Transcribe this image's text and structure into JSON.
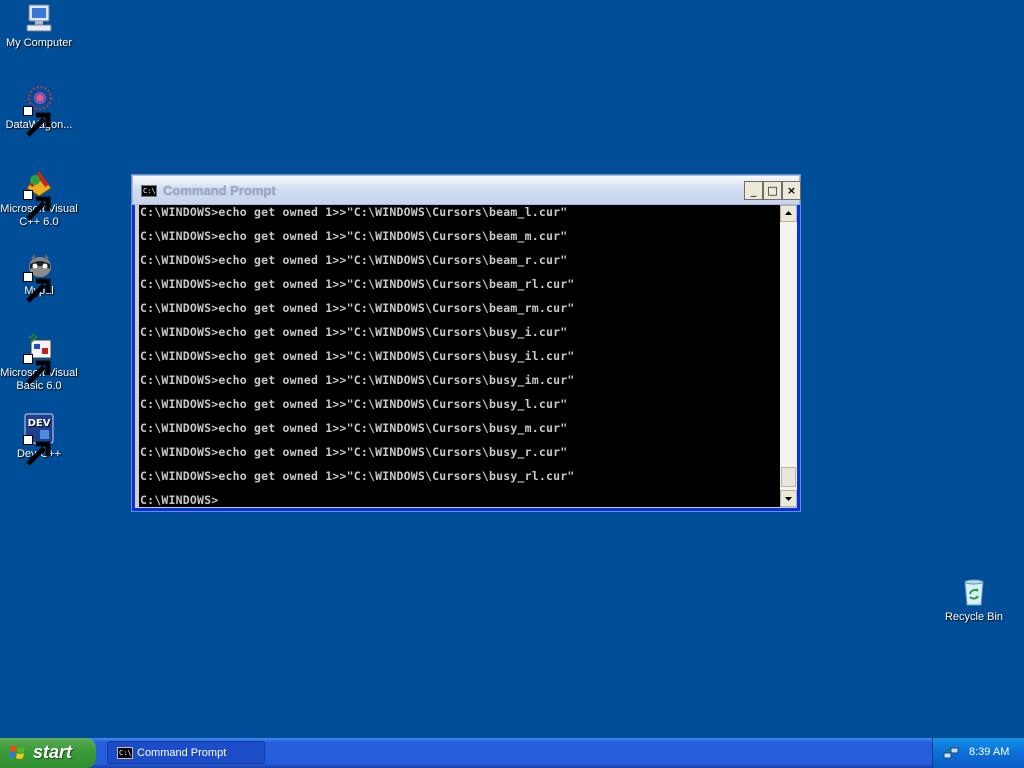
{
  "desktop": {
    "icons": [
      {
        "label": "My Computer",
        "icon": "my-computer-icon"
      },
      {
        "label": "DataWagon...",
        "icon": "datawagon-icon"
      },
      {
        "label": "Microsoft Visual C++ 6.0",
        "icon": "visual-cpp-icon"
      },
      {
        "label": "Mypal",
        "icon": "mypal-icon"
      },
      {
        "label": "Microsoft Visual Basic 6.0",
        "icon": "visual-basic-icon"
      },
      {
        "label": "Dev-C++",
        "icon": "dev-cpp-icon"
      },
      {
        "label": "Recycle Bin",
        "icon": "recycle-bin-icon"
      }
    ]
  },
  "window": {
    "title": "Command Prompt",
    "icon_text": "C:\\",
    "buttons": {
      "minimize": "_",
      "maximize": "□",
      "close": "×"
    },
    "console_lines": [
      "C:\\WINDOWS>echo get owned 1>>\"C:\\WINDOWS\\Cursors\\beam_l.cur\"",
      "C:\\WINDOWS>echo get owned 1>>\"C:\\WINDOWS\\Cursors\\beam_m.cur\"",
      "C:\\WINDOWS>echo get owned 1>>\"C:\\WINDOWS\\Cursors\\beam_r.cur\"",
      "C:\\WINDOWS>echo get owned 1>>\"C:\\WINDOWS\\Cursors\\beam_rl.cur\"",
      "C:\\WINDOWS>echo get owned 1>>\"C:\\WINDOWS\\Cursors\\beam_rm.cur\"",
      "C:\\WINDOWS>echo get owned 1>>\"C:\\WINDOWS\\Cursors\\busy_i.cur\"",
      "C:\\WINDOWS>echo get owned 1>>\"C:\\WINDOWS\\Cursors\\busy_il.cur\"",
      "C:\\WINDOWS>echo get owned 1>>\"C:\\WINDOWS\\Cursors\\busy_im.cur\"",
      "C:\\WINDOWS>echo get owned 1>>\"C:\\WINDOWS\\Cursors\\busy_l.cur\"",
      "C:\\WINDOWS>echo get owned 1>>\"C:\\WINDOWS\\Cursors\\busy_m.cur\"",
      "C:\\WINDOWS>echo get owned 1>>\"C:\\WINDOWS\\Cursors\\busy_r.cur\"",
      "C:\\WINDOWS>echo get owned 1>>\"C:\\WINDOWS\\Cursors\\busy_rl.cur\"",
      "C:\\WINDOWS>"
    ]
  },
  "taskbar": {
    "start_label": "start",
    "tasks": [
      {
        "label": "Command Prompt",
        "icon_text": "C:\\"
      }
    ],
    "clock": "8:39 AM",
    "tray_icon": "network-icon"
  },
  "colors": {
    "desktop": "#004e98",
    "taskbar": "#245edb",
    "start_button": "#3c9b3a",
    "console_bg": "#000000",
    "console_text": "#c8c8c8"
  }
}
